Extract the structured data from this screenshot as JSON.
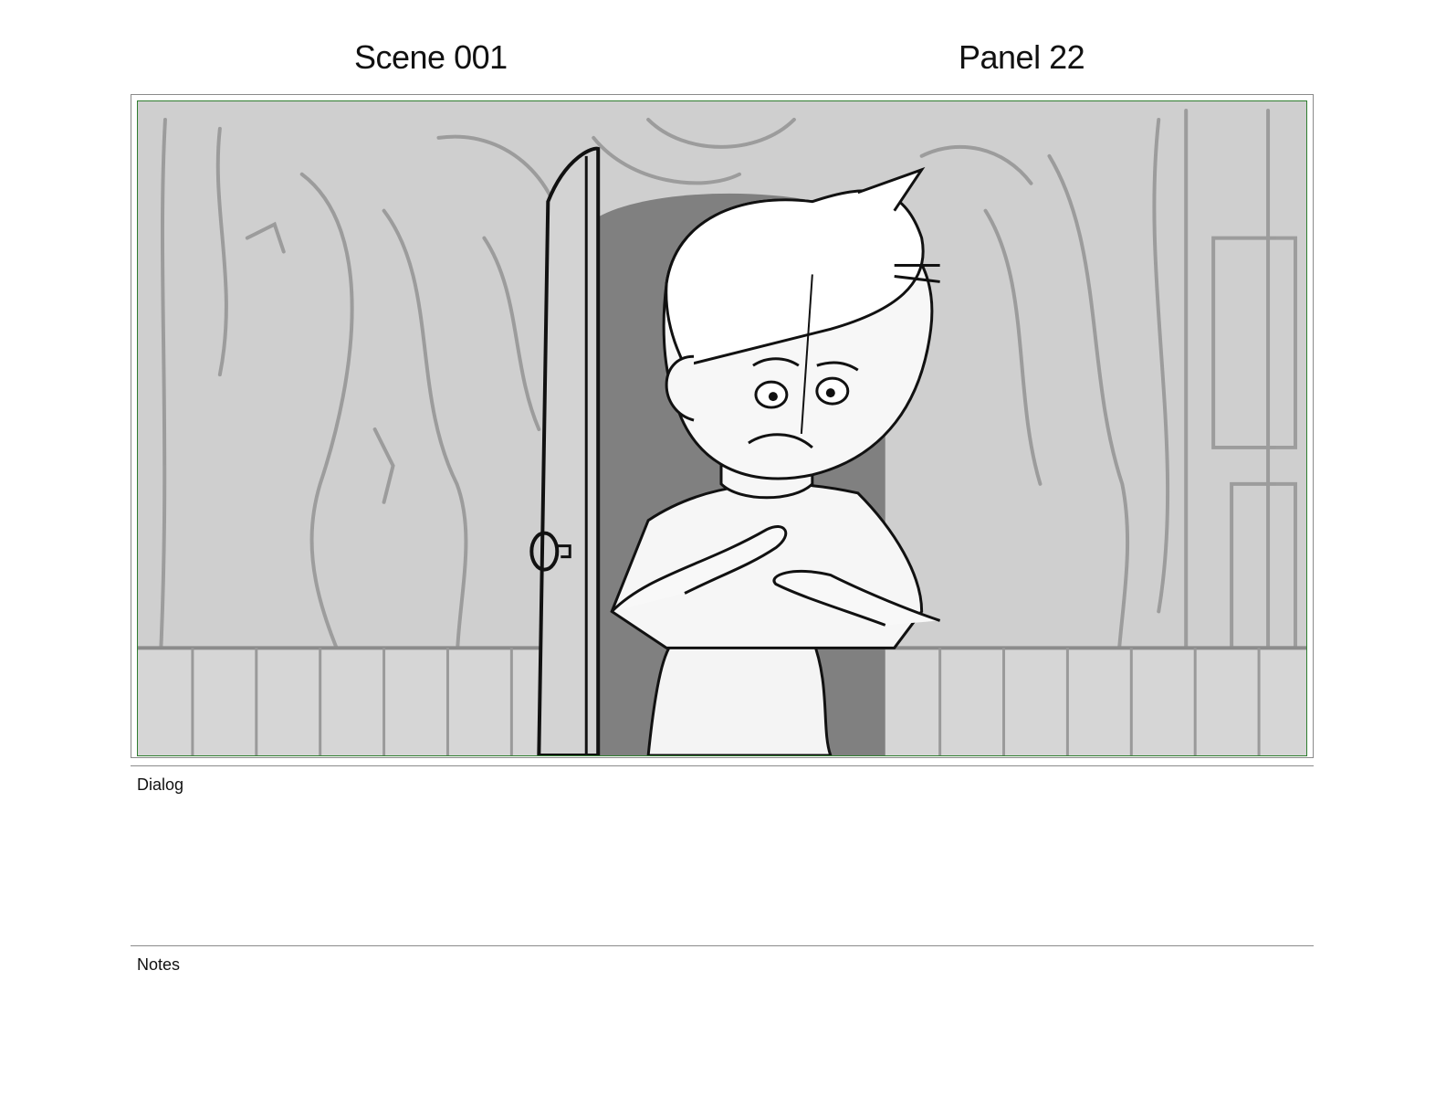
{
  "header": {
    "scene": "Scene 001",
    "panel": "Panel 22"
  },
  "sections": {
    "dialog_label": "Dialog",
    "notes_label": "Notes"
  },
  "colors": {
    "safe_area_border": "#2e7d2e",
    "frame_border": "#8a8a8a",
    "background_wall": "#cfcfcf",
    "doorway_shadow": "#808080"
  }
}
